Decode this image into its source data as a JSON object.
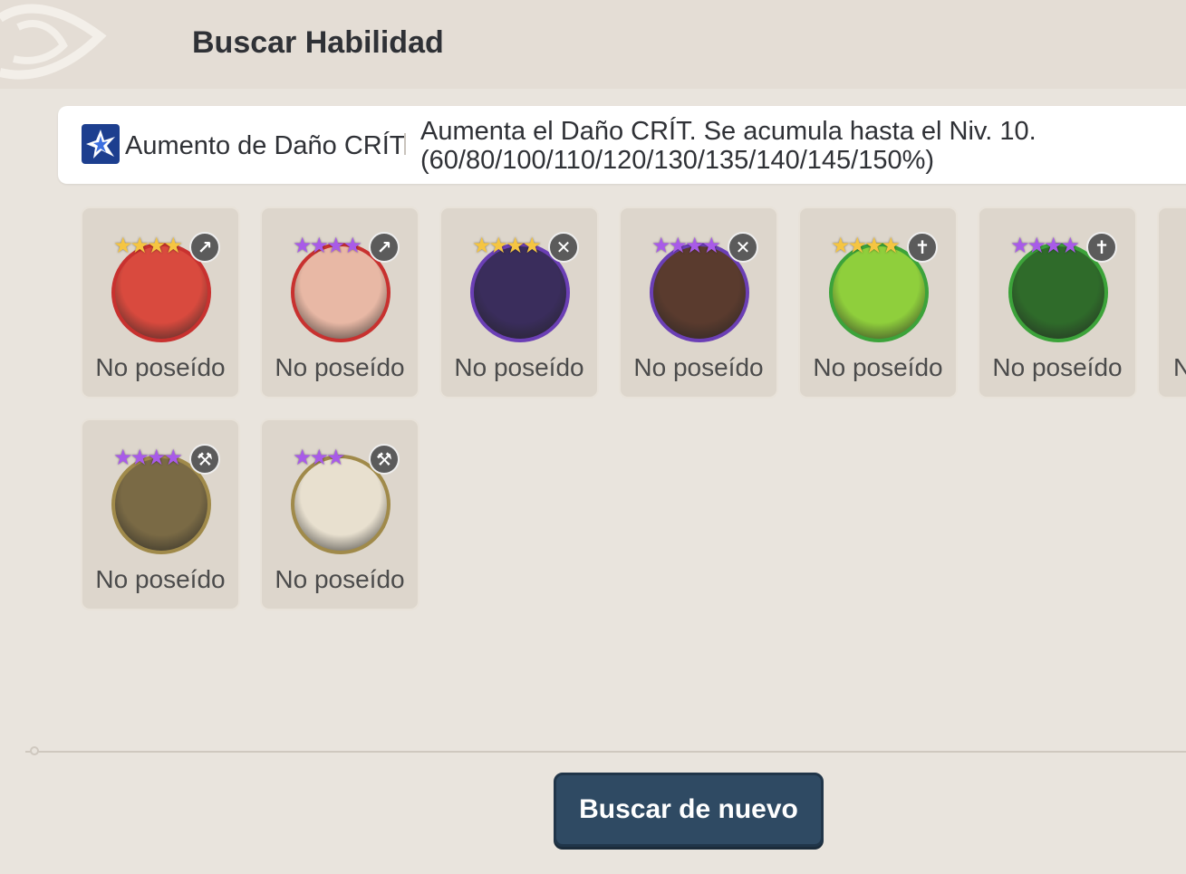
{
  "header": {
    "title": "Buscar Habilidad"
  },
  "skill": {
    "icon": "burst-icon",
    "name": "Aumento de Daño CRÍT",
    "description_line1": "Aumenta el Daño CRÍT. Se acumula hasta el Niv. 10.",
    "description_line2": "(60/80/100/110/120/130/135/140/145/150%)"
  },
  "heroes": [
    {
      "status": "No poseído",
      "stars": 4,
      "star_color": "#f5c542",
      "frame_color": "#c8312f",
      "class_icon": "bow-icon",
      "class_glyph": "↗",
      "fill": "#d94a3e"
    },
    {
      "status": "No poseído",
      "stars": 4,
      "star_color": "#a85be8",
      "frame_color": "#c8312f",
      "class_icon": "bow-icon",
      "class_glyph": "↗",
      "fill": "#e8b8a5"
    },
    {
      "status": "No poseído",
      "stars": 4,
      "star_color": "#f5c542",
      "frame_color": "#6b3fb5",
      "class_icon": "crossed-swords-icon",
      "class_glyph": "✕",
      "fill": "#3a2d5c"
    },
    {
      "status": "No poseído",
      "stars": 4,
      "star_color": "#a85be8",
      "frame_color": "#6b3fb5",
      "class_icon": "crossed-swords-icon",
      "class_glyph": "✕",
      "fill": "#5a3b2e"
    },
    {
      "status": "No poseído",
      "stars": 4,
      "star_color": "#f5c542",
      "frame_color": "#3ca33a",
      "class_icon": "cross-icon",
      "class_glyph": "✝",
      "fill": "#8fcf3c"
    },
    {
      "status": "No poseído",
      "stars": 4,
      "star_color": "#a85be8",
      "frame_color": "#3ca33a",
      "class_icon": "cross-icon",
      "class_glyph": "✝",
      "fill": "#2f6b2a"
    },
    {
      "status": "No poseído",
      "stars": 4,
      "star_color": "#a85be8",
      "frame_color": "#a08a4a",
      "class_icon": "axe-icon",
      "class_glyph": "⚒",
      "fill": "#7a6a45"
    },
    {
      "status": "No poseído",
      "stars": 3,
      "star_color": "#a85be8",
      "frame_color": "#a08a4a",
      "class_icon": "axe-icon",
      "class_glyph": "⚒",
      "fill": "#e8e0cf"
    }
  ],
  "partial_card": {
    "status": "N"
  },
  "footer": {
    "search_again_label": "Buscar de nuevo"
  }
}
